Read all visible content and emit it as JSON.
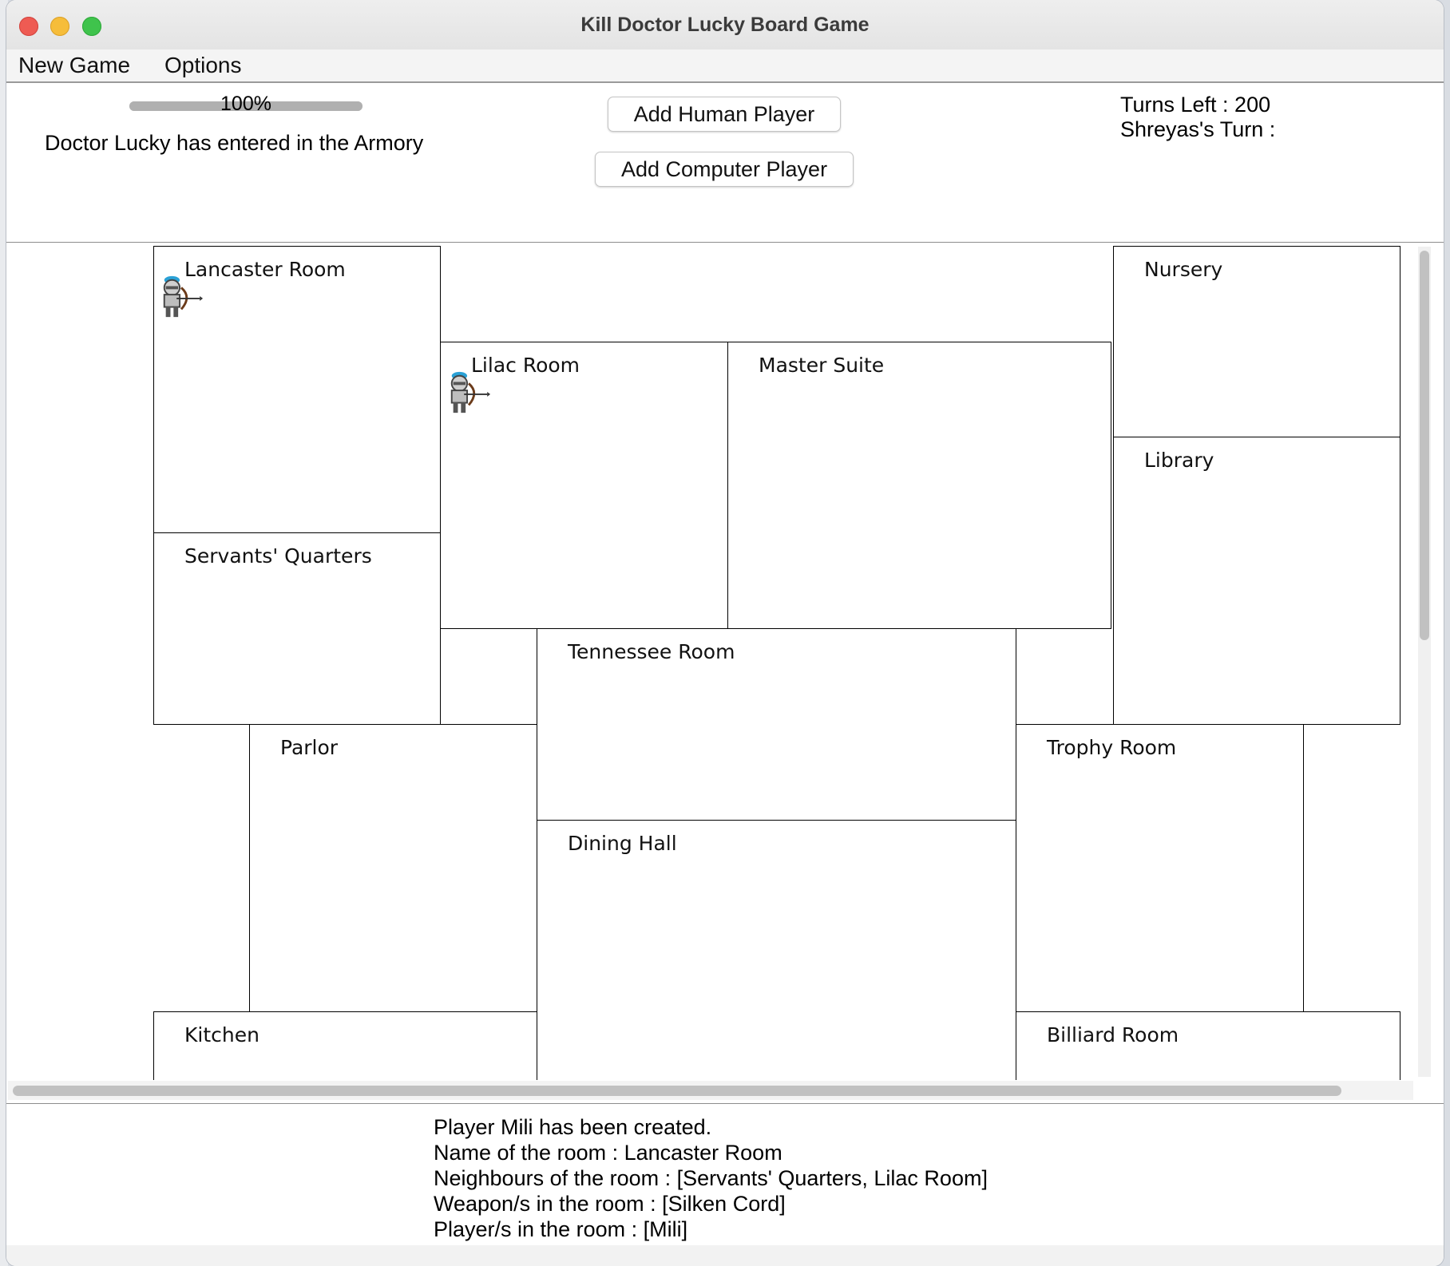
{
  "window": {
    "title": "Kill Doctor Lucky Board Game"
  },
  "menu": {
    "items": [
      "New Game",
      "Options"
    ]
  },
  "top_panel": {
    "progress": {
      "value_percent": 100,
      "label": "100%"
    },
    "status": "Doctor Lucky has entered in the Armory",
    "add_human_label": "Add Human Player",
    "add_computer_label": "Add Computer Player",
    "turns_left": "Turns Left : 200",
    "current_turn": "Shreyas's Turn :"
  },
  "board": {
    "rooms": [
      {
        "name": "Lancaster Room"
      },
      {
        "name": "Nursery"
      },
      {
        "name": "Lilac Room"
      },
      {
        "name": "Master Suite"
      },
      {
        "name": "Library"
      },
      {
        "name": "Servants' Quarters"
      },
      {
        "name": "Tennessee Room"
      },
      {
        "name": "Parlor"
      },
      {
        "name": "Trophy Room"
      },
      {
        "name": "Dining Hall"
      },
      {
        "name": "Kitchen"
      },
      {
        "name": "Billiard Room"
      }
    ],
    "player_icons": [
      "archer-pawn-icon",
      "archer-pawn-icon"
    ]
  },
  "log": {
    "lines": [
      "Player Mili has been created.",
      "Name of the room : Lancaster Room",
      "Neighbours of the room : [Servants' Quarters, Lilac Room]",
      "Weapon/s in the room : [Silken Cord]",
      "Player/s in the room : [Mili]"
    ]
  },
  "colors": {
    "close": "#ee5b53",
    "minimize": "#f6bd3a",
    "maximize": "#3fc34c"
  }
}
